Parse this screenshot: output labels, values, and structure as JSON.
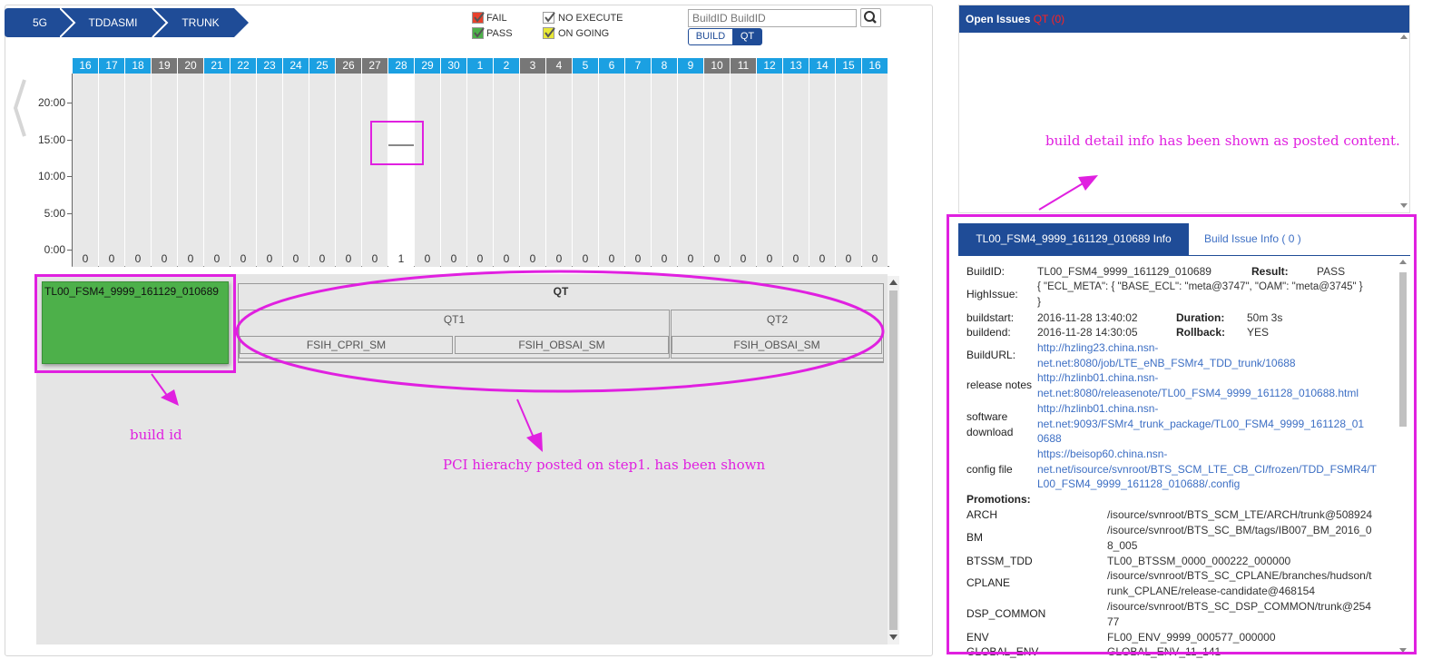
{
  "breadcrumb": [
    "5G",
    "TDDASMI",
    "TRUNK"
  ],
  "legend": {
    "fail": "FAIL",
    "pass": "PASS",
    "no_execute": "NO EXECUTE",
    "on_going": "ON GOING",
    "colors": {
      "fail": "#e8412c",
      "pass": "#4db04a",
      "no_execute": "#ffffff",
      "on_going": "#e8e836"
    }
  },
  "search": {
    "placeholder": "BuildID BuildID",
    "icon": "search-icon",
    "build_label": "BUILD",
    "qt_label": "QT"
  },
  "chart": {
    "days": [
      {
        "d": "16",
        "c": "0",
        "w": false
      },
      {
        "d": "17",
        "c": "0",
        "w": false
      },
      {
        "d": "18",
        "c": "0",
        "w": false
      },
      {
        "d": "19",
        "c": "0",
        "w": true
      },
      {
        "d": "20",
        "c": "0",
        "w": true
      },
      {
        "d": "21",
        "c": "0",
        "w": false
      },
      {
        "d": "22",
        "c": "0",
        "w": false
      },
      {
        "d": "23",
        "c": "0",
        "w": false
      },
      {
        "d": "24",
        "c": "0",
        "w": false
      },
      {
        "d": "25",
        "c": "0",
        "w": false
      },
      {
        "d": "26",
        "c": "0",
        "w": true
      },
      {
        "d": "27",
        "c": "0",
        "w": true
      },
      {
        "d": "28",
        "c": "1",
        "w": false
      },
      {
        "d": "29",
        "c": "0",
        "w": false
      },
      {
        "d": "30",
        "c": "0",
        "w": false
      },
      {
        "d": "1",
        "c": "0",
        "w": false
      },
      {
        "d": "2",
        "c": "0",
        "w": false
      },
      {
        "d": "3",
        "c": "0",
        "w": true
      },
      {
        "d": "4",
        "c": "0",
        "w": true
      },
      {
        "d": "5",
        "c": "0",
        "w": false
      },
      {
        "d": "6",
        "c": "0",
        "w": false
      },
      {
        "d": "7",
        "c": "0",
        "w": false
      },
      {
        "d": "8",
        "c": "0",
        "w": false
      },
      {
        "d": "9",
        "c": "0",
        "w": false
      },
      {
        "d": "10",
        "c": "0",
        "w": true
      },
      {
        "d": "11",
        "c": "0",
        "w": true
      },
      {
        "d": "12",
        "c": "0",
        "w": false
      },
      {
        "d": "13",
        "c": "0",
        "w": false
      },
      {
        "d": "14",
        "c": "0",
        "w": false
      },
      {
        "d": "15",
        "c": "0",
        "w": false
      },
      {
        "d": "16",
        "c": "0",
        "w": false
      }
    ],
    "selected_day": "28",
    "yticks": [
      "20:00",
      "15:00",
      "10:00",
      "5:00",
      "0:00"
    ],
    "colors": {
      "day": "#1ba0e2",
      "weekend": "#777777",
      "column": "#e8e8e8",
      "selected": "#ffffff"
    }
  },
  "hierarchy": {
    "build_id": "TL00_FSM4_9999_161129_010689",
    "root": "QT",
    "groups": [
      {
        "name": "QT1",
        "children": [
          "FSIH_CPRI_SM",
          "FSIH_OBSAI_SM"
        ]
      },
      {
        "name": "QT2",
        "children": [
          "FSIH_OBSAI_SM"
        ]
      }
    ]
  },
  "annotations": {
    "build_id": "build id",
    "pci": "PCI hierachy posted on step1. has been shown",
    "detail": "build detail info has been shown as posted content."
  },
  "issues": {
    "title": "Open Issues",
    "suffix": "QT (0)"
  },
  "detail": {
    "tab_info": "TL00_FSM4_9999_161129_010689 Info",
    "tab_issue": "Build Issue Info ( 0 )",
    "build_id_label": "BuildID:",
    "build_id": "TL00_FSM4_9999_161129_010689",
    "result_label": "Result:",
    "result": "PASS",
    "high_issue_label": "HighIssue:",
    "high_issue": "{ \"ECL_META\": { \"BASE_ECL\": \"meta@3747\", \"OAM\": \"meta@3745\" }",
    "high_issue_end": "}",
    "buildstart_label": "buildstart:",
    "buildstart": "2016-11-28 13:40:02",
    "duration_label": "Duration:",
    "duration": "50m 3s",
    "buildend_label": "buildend:",
    "buildend": "2016-11-28 14:30:05",
    "rollback_label": "Rollback:",
    "rollback": "YES",
    "buildurl_label": "BuildURL:",
    "buildurl_1": "http://hzling23.china.nsn-",
    "buildurl_2": "net.net:8080/job/LTE_eNB_FSMr4_TDD_trunk/10688",
    "release_label": "release notes",
    "release_1": "http://hzlinb01.china.nsn-",
    "release_2": "net.net:8080/releasenote/TL00_FSM4_9999_161128_010688.html",
    "software_label_1": "software",
    "software_label_2": "download",
    "software_1": "http://hzlinb01.china.nsn-",
    "software_2": "net.net:9093/FSMr4_trunk_package/TL00_FSM4_9999_161128_01",
    "software_3": "0688",
    "config_label": "config file",
    "config_1": "https://beisop60.china.nsn-",
    "config_2": "net.net/isource/svnroot/BTS_SCM_LTE_CB_CI/frozen/TDD_FSMR4/T",
    "config_3": "L00_FSM4_9999_161128_010688/.config",
    "promotions_label": "Promotions:",
    "promotions": [
      {
        "name": "ARCH",
        "l1": "/isource/svnroot/BTS_SCM_LTE/ARCH/trunk@508924",
        "l2": ""
      },
      {
        "name": "BM",
        "l1": "/isource/svnroot/BTS_SC_BM/tags/IB007_BM_2016_0",
        "l2": "8_005"
      },
      {
        "name": "BTSSM_TDD",
        "l1": "TL00_BTSSM_0000_000222_000000",
        "l2": ""
      },
      {
        "name": "CPLANE",
        "l1": "/isource/svnroot/BTS_SC_CPLANE/branches/hudson/t",
        "l2": "runk_CPLANE/release-candidate@468154"
      },
      {
        "name": "DSP_COMMON",
        "l1": "/isource/svnroot/BTS_SC_DSP_COMMON/trunk@254",
        "l2": "77"
      },
      {
        "name": "ENV",
        "l1": "FL00_ENV_9999_000577_000000",
        "l2": ""
      },
      {
        "name": "GLOBAL_ENV",
        "l1": "GLOBAL_ENV_11_141",
        "l2": ""
      }
    ]
  }
}
